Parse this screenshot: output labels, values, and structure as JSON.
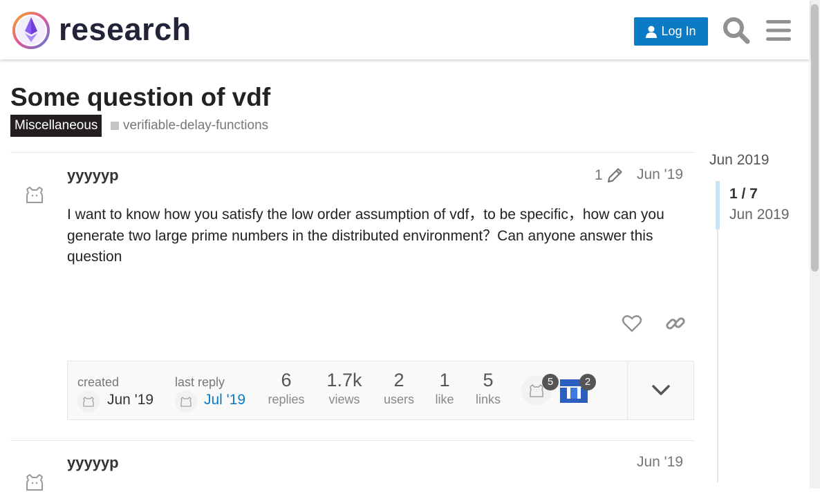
{
  "header": {
    "brand": "research",
    "login_label": "Log In",
    "search_icon": "search-icon",
    "menu_icon": "hamburger-menu-icon"
  },
  "topic": {
    "title": "Some question of vdf",
    "category": "Miscellaneous",
    "tag": "verifiable-delay-functions"
  },
  "posts": [
    {
      "username": "yyyyyp",
      "edit_count": "1",
      "date": "Jun '19",
      "body": "I want to know how you satisfy the low order assumption of vdf，to be specific，how can you generate two large prime numbers in the distributed environment？Can anyone answer this question"
    },
    {
      "username": "yyyyyp",
      "date": "Jun '19"
    }
  ],
  "topic_map": {
    "created_label": "created",
    "created_date": "Jun '19",
    "last_reply_label": "last reply",
    "last_reply_date": "Jul '19",
    "stats": [
      {
        "num": "6",
        "label": "replies"
      },
      {
        "num": "1.7k",
        "label": "views"
      },
      {
        "num": "2",
        "label": "users"
      },
      {
        "num": "1",
        "label": "like"
      },
      {
        "num": "5",
        "label": "links"
      }
    ],
    "participants": [
      {
        "count": "5"
      },
      {
        "count": "2"
      }
    ]
  },
  "timeline": {
    "top_date": "Jun 2019",
    "position": "1 / 7",
    "current_date": "Jun 2019"
  },
  "colors": {
    "accent": "#0a7bc4",
    "category_bg": "#231f20"
  }
}
